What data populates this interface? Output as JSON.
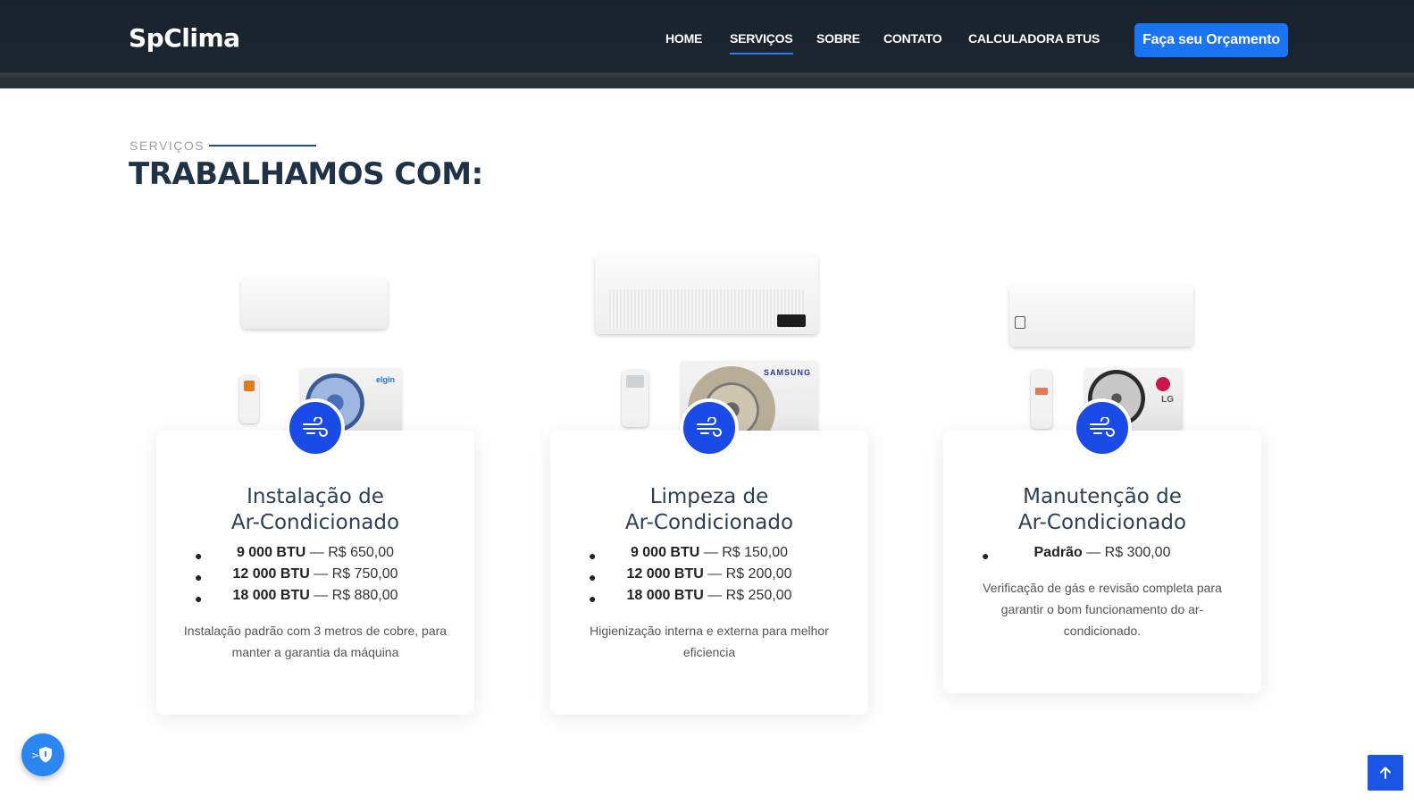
{
  "brand": {
    "name": "SpClima"
  },
  "nav": {
    "items": [
      {
        "label": "HOME"
      },
      {
        "label": "SERVIÇOS"
      },
      {
        "label": "SOBRE"
      },
      {
        "label": "CONTATO"
      },
      {
        "label": "CALCULADORA BTUS"
      }
    ],
    "cta_label": "Faça seu Orçamento"
  },
  "section": {
    "kicker": "SERVIÇOS",
    "title": "TRABALHAMOS COM:"
  },
  "cards": [
    {
      "title_line1": "Instalação de",
      "title_line2": "Ar-Condicionado",
      "icon": "wind-icon",
      "prices": [
        {
          "bold": "9 000 BTU",
          "rest": " — R$ 650,00"
        },
        {
          "bold": "12 000 BTU",
          "rest": " — R$ 750,00"
        },
        {
          "bold": "18 000 BTU",
          "rest": " — R$ 880,00"
        }
      ],
      "description": "Instalação padrão com 3 metros de cobre, para manter a garantia da máquina"
    },
    {
      "title_line1": "Limpeza de",
      "title_line2": "Ar-Condicionado",
      "icon": "wind-icon",
      "prices": [
        {
          "bold": "9 000 BTU",
          "rest": " — R$ 150,00"
        },
        {
          "bold": "12 000 BTU",
          "rest": " — R$ 200,00"
        },
        {
          "bold": "18 000 BTU",
          "rest": " — R$ 250,00"
        }
      ],
      "description": "Higienização interna e externa para melhor eficiencia"
    },
    {
      "title_line1": "Manutenção de",
      "title_line2": "Ar-Condicionado",
      "icon": "wind-icon",
      "prices": [
        {
          "bold": "Padrão",
          "rest": " — R$ 300,00"
        }
      ],
      "description": "Verificação de gás e revisão completa para garantir o bom funcionamento do ar-condicionado."
    }
  ],
  "products": [
    {
      "brand_label": "elgin"
    },
    {
      "brand_label": "SAMSUNG"
    },
    {
      "brand_label": "LG"
    }
  ],
  "floating": {
    "shield_icon": "shield-icon",
    "top_icon": "arrow-up-icon"
  },
  "colors": {
    "header_bg": "#18222d",
    "accent": "#1a73f0",
    "icon_bg": "#1a4be6",
    "title": "#1f3246"
  }
}
